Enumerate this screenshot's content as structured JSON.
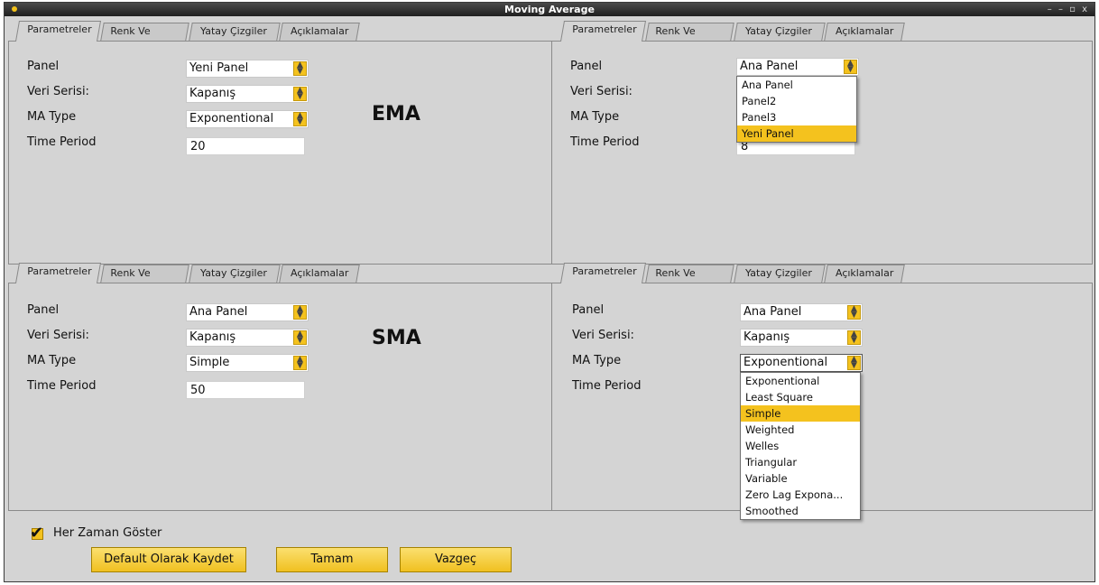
{
  "window": {
    "title": "Moving Average",
    "controls": "– – ▫ x"
  },
  "tabs": [
    "Parametreler",
    "Renk Ve Çizim",
    "Yatay Çizgiler",
    "Açıklamalar"
  ],
  "labels": {
    "panel": "Panel",
    "veri": "Veri Serisi:",
    "matype": "MA Type",
    "period": "Time Period"
  },
  "q1": {
    "panel": "Yeni Panel",
    "veri": "Kapanış",
    "matype": "Exponentional",
    "period": "20",
    "tag": "EMA"
  },
  "q2": {
    "panel": "Ana Panel",
    "period": "8",
    "dropdown": [
      "Ana Panel",
      "Panel2",
      "Panel3",
      "Yeni Panel"
    ],
    "selected": "Yeni Panel"
  },
  "q3": {
    "panel": "Ana Panel",
    "veri": "Kapanış",
    "matype": "Simple",
    "period": "50",
    "tag": "SMA"
  },
  "q4": {
    "panel": "Ana Panel",
    "veri": "Kapanış",
    "matype": "Exponentional",
    "dropdown": [
      "Exponentional",
      "Least Square",
      "Simple",
      "Weighted",
      "Welles",
      "Triangular",
      "Variable",
      "Zero Lag Expona...",
      "Smoothed"
    ],
    "selected": "Simple"
  },
  "footer": {
    "always_show": "Her Zaman Göster",
    "default_btn": "Default Olarak Kaydet",
    "ok_btn": "Tamam",
    "cancel_btn": "Vazgeç"
  },
  "colors": {
    "accent": "#f4c21e",
    "titlebar": "#2b2b2b",
    "background": "#d4d4d4"
  }
}
